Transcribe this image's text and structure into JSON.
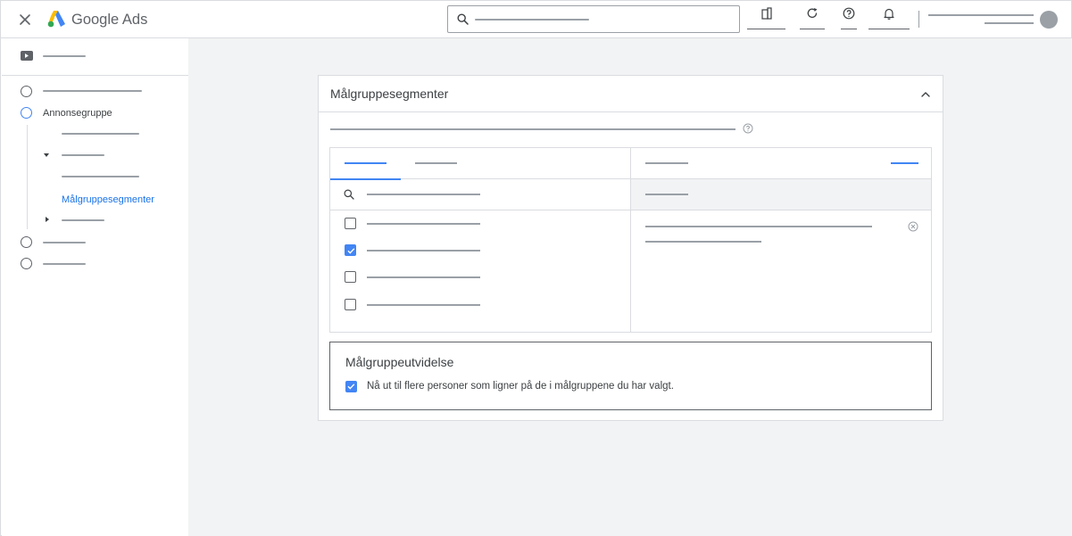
{
  "app": {
    "brand_google": "Google",
    "brand_ads": "Ads"
  },
  "icons": {
    "close": "close-icon",
    "logo": "google-ads-logo",
    "search": "search-icon",
    "reports": "reports-icon",
    "refresh": "refresh-icon",
    "help": "help-icon",
    "notifications": "bell-icon",
    "collapse": "chevron-up-icon",
    "remove": "remove-circle-icon"
  },
  "colors": {
    "accent": "#4285f4",
    "link": "#1a73e8",
    "muted": "#9aa0a6",
    "text": "#3c4043",
    "page_bg": "#f1f3f4",
    "logo_blue": "#4285f4",
    "logo_yellow": "#fbbc04",
    "logo_green": "#34a853"
  },
  "sidebar": {
    "step_ad_group": "Annonsegruppe",
    "substep_active": "Målgruppesegmenter"
  },
  "card": {
    "title": "Målgruppesegmenter"
  },
  "left_panel": {
    "rows": [
      {
        "checked": false
      },
      {
        "checked": true
      },
      {
        "checked": false
      },
      {
        "checked": false
      }
    ]
  },
  "expansion": {
    "title": "Målgruppeutvidelse",
    "checkbox_checked": true,
    "checkbox_label": "Nå ut til flere personer som ligner på de i målgruppene du har valgt."
  }
}
